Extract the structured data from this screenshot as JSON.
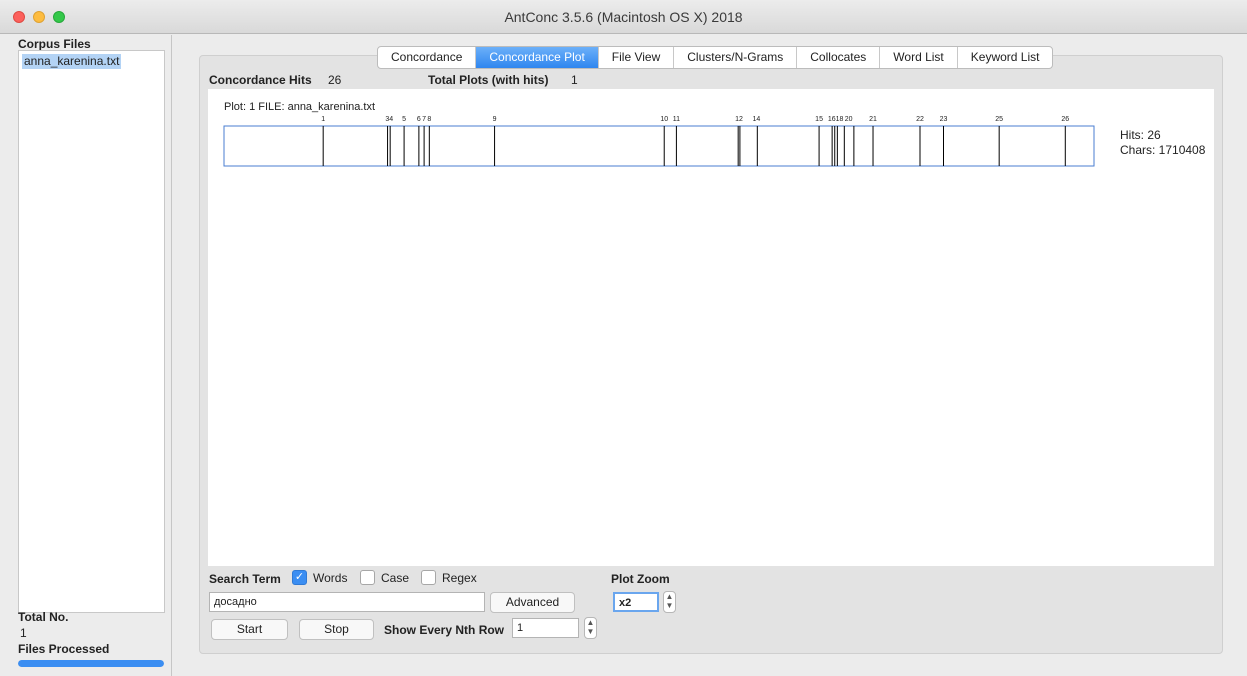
{
  "window": {
    "title": "AntConc 3.5.6 (Macintosh OS X) 2018"
  },
  "sidebar": {
    "corpus_label": "Corpus Files",
    "files": [
      "anna_karenina.txt"
    ],
    "total_label": "Total No.",
    "total_value": "1",
    "processed_label": "Files Processed",
    "progress": 1.0
  },
  "tabs": [
    {
      "label": "Concordance",
      "active": false
    },
    {
      "label": "Concordance Plot",
      "active": true
    },
    {
      "label": "File View",
      "active": false
    },
    {
      "label": "Clusters/N-Grams",
      "active": false
    },
    {
      "label": "Collocates",
      "active": false
    },
    {
      "label": "Word List",
      "active": false
    },
    {
      "label": "Keyword List",
      "active": false
    }
  ],
  "summary": {
    "hits_label": "Concordance Hits",
    "hits_value": "26",
    "plots_label": "Total Plots (with hits)",
    "plots_value": "1"
  },
  "plot": {
    "header": "Plot: 1   FILE: anna_karenina.txt",
    "hits_text": "Hits: 26",
    "chars_text": "Chars: 1710408",
    "hit_positions": [
      0.114,
      0.188,
      0.191,
      0.207,
      0.224,
      0.23,
      0.236,
      0.311,
      0.506,
      0.52,
      0.591,
      0.593,
      0.613,
      0.684,
      0.699,
      0.702,
      0.705,
      0.713,
      0.724,
      0.746,
      0.8,
      0.827,
      0.891,
      0.967
    ],
    "hit_labels": [
      {
        "pos": 0.114,
        "text": "1"
      },
      {
        "pos": 0.19,
        "text": "34"
      },
      {
        "pos": 0.207,
        "text": "5"
      },
      {
        "pos": 0.224,
        "text": "6"
      },
      {
        "pos": 0.23,
        "text": "7"
      },
      {
        "pos": 0.236,
        "text": "8"
      },
      {
        "pos": 0.311,
        "text": "9"
      },
      {
        "pos": 0.506,
        "text": "10"
      },
      {
        "pos": 0.52,
        "text": "11"
      },
      {
        "pos": 0.592,
        "text": "12"
      },
      {
        "pos": 0.612,
        "text": "14"
      },
      {
        "pos": 0.684,
        "text": "15"
      },
      {
        "pos": 0.703,
        "text": "1618"
      },
      {
        "pos": 0.718,
        "text": "20"
      },
      {
        "pos": 0.746,
        "text": "21"
      },
      {
        "pos": 0.8,
        "text": "22"
      },
      {
        "pos": 0.827,
        "text": "23"
      },
      {
        "pos": 0.891,
        "text": "25"
      },
      {
        "pos": 0.967,
        "text": "26"
      }
    ]
  },
  "controls": {
    "search_label": "Search Term",
    "words_label": "Words",
    "words_checked": true,
    "case_label": "Case",
    "case_checked": false,
    "regex_label": "Regex",
    "regex_checked": false,
    "search_value": "досадно",
    "advanced_label": "Advanced",
    "start_label": "Start",
    "stop_label": "Stop",
    "nth_row_label": "Show Every Nth Row",
    "nth_row_value": "1",
    "zoom_label": "Plot Zoom",
    "zoom_value": "x2"
  }
}
